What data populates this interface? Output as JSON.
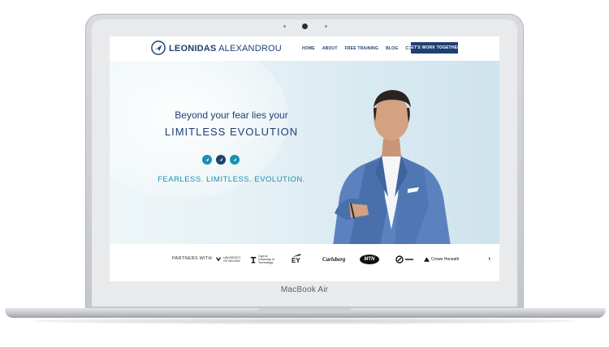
{
  "device": {
    "label": "MacBook Air"
  },
  "site": {
    "logo": {
      "first": "LEONIDAS",
      "last": "ALEXANDROU"
    },
    "nav": [
      "HOME",
      "ABOUT",
      "FREE TRAINING",
      "BLOG",
      "CONTACT"
    ],
    "cta": "LET'S WORK TOGETHER",
    "hero": {
      "tagline_line1": "Beyond your fear lies your",
      "tagline_line2": "LIMITLESS EVOLUTION",
      "slogan": "FEARLESS. LIMITLESS. EVOLUTION.",
      "badges": [
        "#1a8fb0",
        "#1d3f73",
        "#1a8fb0"
      ]
    },
    "partners": {
      "label": "PARTNERS WITH:",
      "items": [
        {
          "name": "UNIVERSITY OF NICOSIA",
          "line1": "UNIVERSITY",
          "line2": "OF NICOSIA"
        },
        {
          "name": "Cyprus University of Technology",
          "line1": "Cyprus",
          "line2": "University of",
          "line3": "Technology"
        },
        {
          "name": "EY",
          "text": "EY"
        },
        {
          "name": "Carlsberg",
          "text": "Carlsberg"
        },
        {
          "name": "MTN",
          "text": "MTN"
        },
        {
          "name": "partner-six",
          "line1": ""
        },
        {
          "name": "Crowe Horwath",
          "text": "Crowe Horwath"
        }
      ]
    },
    "colors": {
      "navy": "#1d3f73",
      "teal": "#1a8fb0"
    }
  }
}
